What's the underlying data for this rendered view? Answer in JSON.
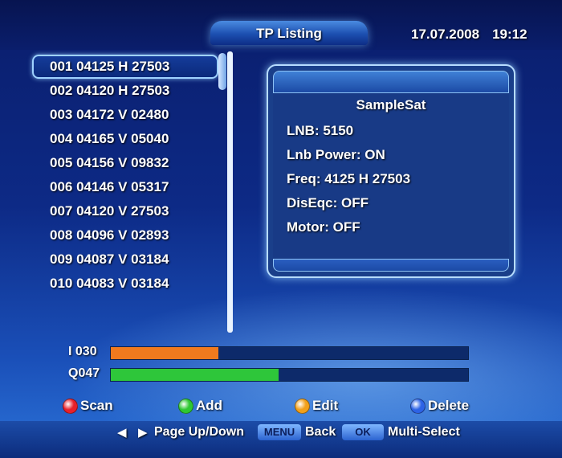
{
  "header": {
    "title": "TP Listing",
    "date": "17.07.2008",
    "time": "19:12"
  },
  "tp_list": {
    "rows": [
      {
        "label": "001 04125 H 27503",
        "selected": true
      },
      {
        "label": "002 04120 H 27503",
        "selected": false
      },
      {
        "label": "003 04172 V 02480",
        "selected": false
      },
      {
        "label": "004 04165 V 05040",
        "selected": false
      },
      {
        "label": "005 04156 V 09832",
        "selected": false
      },
      {
        "label": "006 04146 V 05317",
        "selected": false
      },
      {
        "label": "007 04120 V 27503",
        "selected": false
      },
      {
        "label": "008 04096 V 02893",
        "selected": false
      },
      {
        "label": "009 04087 V 03184",
        "selected": false
      },
      {
        "label": "010 04083 V 03184",
        "selected": false
      }
    ]
  },
  "info": {
    "satellite": "SampleSat",
    "lnb": "LNB: 5150",
    "lnb_power": "Lnb Power: ON",
    "freq": "Freq: 4125 H 27503",
    "diseqc": "DisEqc: OFF",
    "motor": "Motor: OFF"
  },
  "signal": {
    "intensity_label": "I 030",
    "intensity_level": 0.3,
    "intensity_color": "#f07a1e",
    "quality_label": "Q047",
    "quality_level": 0.47,
    "quality_color": "#2ec63a"
  },
  "legend": {
    "scan": {
      "label": "Scan",
      "color": "#e8202a"
    },
    "add": {
      "label": "Add",
      "color": "#2fc832"
    },
    "edit": {
      "label": "Edit",
      "color": "#f2a01a"
    },
    "delete": {
      "label": "Delete",
      "color": "#2d63e6"
    }
  },
  "hints": {
    "left_arrow": "◀",
    "right_arrow": "▶",
    "page": "Page Up/Down",
    "menu_key": "MENU",
    "back": "Back",
    "ok_key": "OK",
    "multi": "Multi-Select"
  }
}
